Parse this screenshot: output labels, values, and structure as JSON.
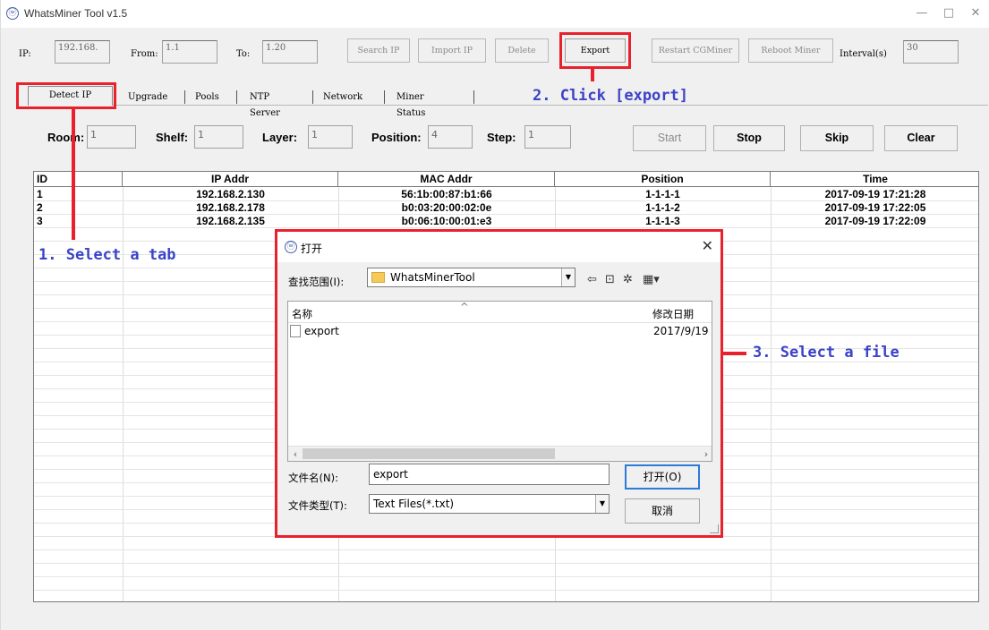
{
  "window": {
    "title": "WhatsMiner Tool v1.5",
    "minimize": "—",
    "maximize": "□",
    "close": "✕"
  },
  "toolbar": {
    "ip_label": "IP:",
    "ip_value": "192.168.",
    "from_label": "From:",
    "from_value": "1.1",
    "to_label": "To:",
    "to_value": "1.20",
    "search_ip": "Search IP",
    "import_ip": "Import IP",
    "delete": "Delete",
    "export": "Export",
    "restart_cgminer": "Restart CGMiner",
    "reboot_miner": "Reboot Miner",
    "interval_label": "Interval(s)",
    "interval_value": "30"
  },
  "tabs": [
    {
      "label": "Detect IP",
      "active": true
    },
    {
      "label": "Upgrade"
    },
    {
      "label": "Pools"
    },
    {
      "label": "NTP Server"
    },
    {
      "label": "Network"
    },
    {
      "label": "Miner Status"
    }
  ],
  "detect": {
    "room_label": "Room:",
    "room_value": "1",
    "shelf_label": "Shelf:",
    "shelf_value": "1",
    "layer_label": "Layer:",
    "layer_value": "1",
    "position_label": "Position:",
    "position_value": "4",
    "step_label": "Step:",
    "step_value": "1",
    "start": "Start",
    "stop": "Stop",
    "skip": "Skip",
    "clear": "Clear"
  },
  "table": {
    "headers": [
      "ID",
      "IP Addr",
      "MAC Addr",
      "Position",
      "Time"
    ],
    "rows": [
      [
        "1",
        "192.168.2.130",
        "56:1b:00:87:b1:66",
        "1-1-1-1",
        "2017-09-19 17:21:28"
      ],
      [
        "2",
        "192.168.2.178",
        "b0:03:20:00:02:0e",
        "1-1-1-2",
        "2017-09-19 17:22:05"
      ],
      [
        "3",
        "192.168.2.135",
        "b0:06:10:00:01:e3",
        "1-1-1-3",
        "2017-09-19 17:22:09"
      ]
    ]
  },
  "annotations": {
    "step1": "1. Select a tab",
    "step2": "2. Click [export]",
    "step3": "3. Select a file",
    "accent_color": "#e8212c",
    "text_color": "#3b43c7"
  },
  "dialog": {
    "title": "打开",
    "close": "✕",
    "lookin_label": "查找范围(I):",
    "lookin_value": "WhatsMinerTool",
    "col_name": "名称",
    "col_modified": "修改日期",
    "sort_caret": "^",
    "file_name": "export",
    "file_modified": "2017/9/19",
    "filename_label": "文件名(N):",
    "filename_value": "export",
    "filetype_label": "文件类型(T):",
    "filetype_value": "Text Files(*.txt)",
    "open_button": "打开(O)",
    "cancel_button": "取消"
  }
}
